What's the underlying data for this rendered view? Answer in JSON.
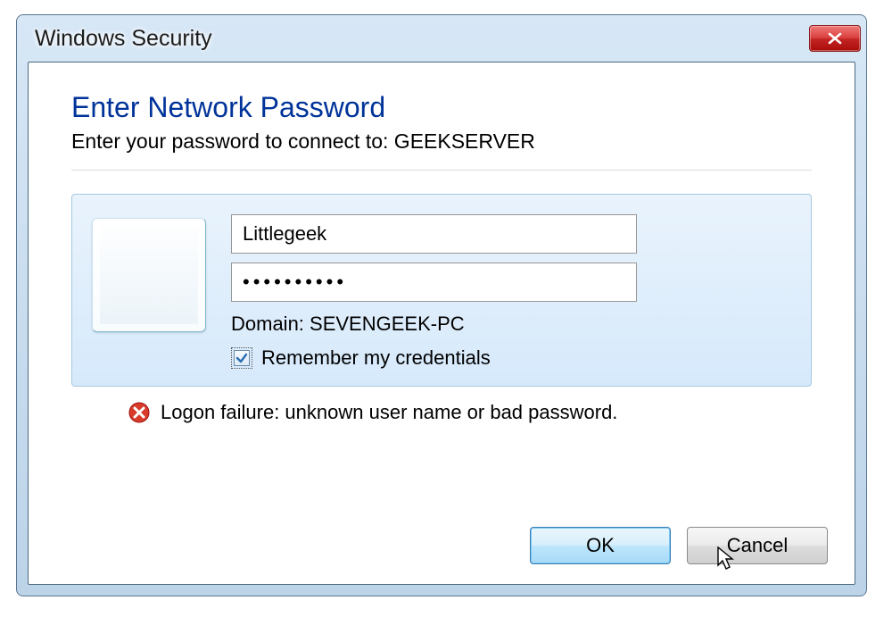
{
  "window": {
    "title": "Windows Security"
  },
  "heading": {
    "main": "Enter Network Password",
    "sub": "Enter your password to connect to: GEEKSERVER"
  },
  "credentials": {
    "username": "Littlegeek",
    "password_mask": "••••••••••",
    "domain_label": "Domain: SEVENGEEK-PC",
    "remember_label": "Remember my credentials",
    "remember_checked": true
  },
  "error": {
    "message": "Logon failure: unknown user name or bad password."
  },
  "buttons": {
    "ok": "OK",
    "cancel": "Cancel"
  }
}
